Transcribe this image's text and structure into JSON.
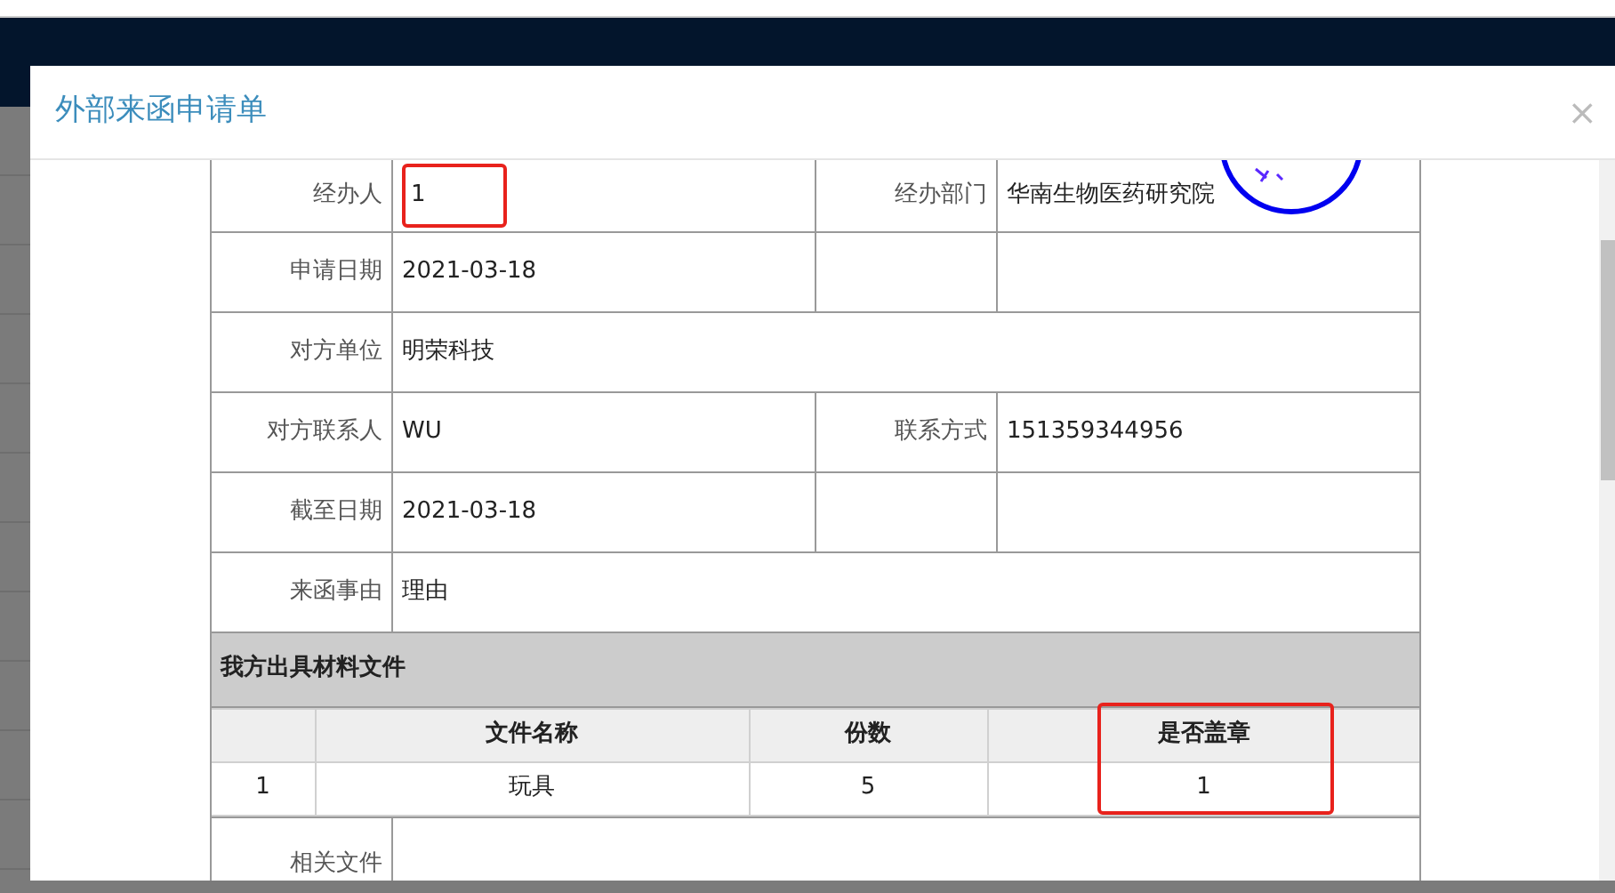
{
  "dialog": {
    "title": "外部来函申请单",
    "close": "×",
    "rows": [
      {
        "cells": [
          {
            "label": "经办人",
            "value": "1",
            "highlighted": true
          },
          {
            "label": "经办部门",
            "value": "华南生物医药研究院",
            "highlighted": false
          }
        ]
      },
      {
        "cells": [
          {
            "label": "申请日期",
            "value": "2021-03-18",
            "highlighted": false
          },
          {
            "highlighted": false
          }
        ]
      },
      {
        "cells": [
          {
            "label": "对方单位",
            "value": "明荣科技",
            "highlighted": false
          }
        ]
      },
      {
        "cells": [
          {
            "label": "对方联系人",
            "value": "WU",
            "highlighted": false
          },
          {
            "label": "联系方式",
            "value": "151359344956",
            "highlighted": false
          }
        ]
      },
      {
        "cells": [
          {
            "label": "截至日期",
            "value": "2021-03-18",
            "highlighted": false
          },
          {
            "highlighted": false
          }
        ]
      },
      {
        "cells": [
          {
            "label": "来函事由",
            "value": "理由",
            "highlighted": false
          }
        ]
      }
    ],
    "section": "我方出具材料文件",
    "materials": {
      "columns": [
        {
          "highlighted": false
        },
        {
          "label": "文件名称",
          "highlighted": false
        },
        {
          "label": "份数",
          "highlighted": false
        },
        {
          "label": "是否盖章",
          "highlighted": true
        }
      ],
      "rows": [
        [
          "1",
          "玩具",
          "5",
          "1"
        ]
      ]
    },
    "related_label": "相关文件"
  }
}
